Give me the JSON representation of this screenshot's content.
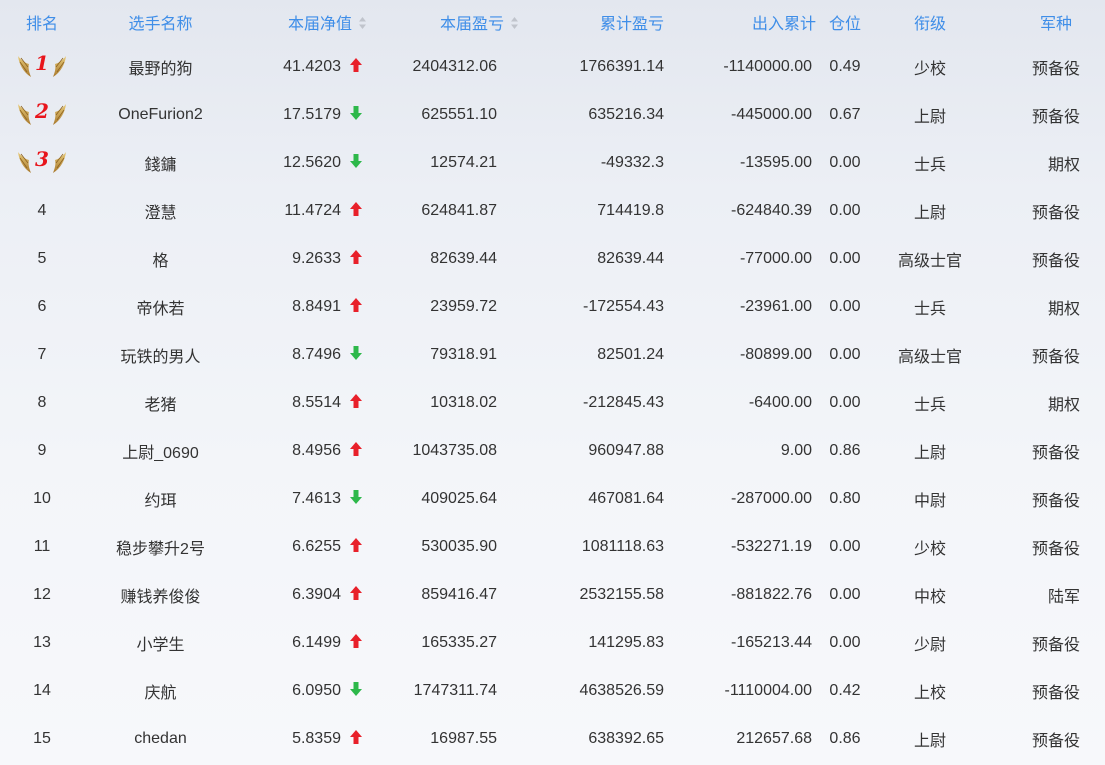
{
  "headers": {
    "rank": "排名",
    "name": "选手名称",
    "nav": "本届净值",
    "pnl": "本届盈亏",
    "cum": "累计盈亏",
    "flow": "出入累计",
    "pos": "仓位",
    "title": "衔级",
    "branch": "军种"
  },
  "colors": {
    "header_text": "#3f8ee8",
    "up_arrow": "#e8202a",
    "down_arrow": "#2db84a",
    "medal_number": "#e8151c"
  },
  "rows": [
    {
      "rank": "1",
      "name": "最野的狗",
      "nav": "41.4203",
      "trend": "up",
      "pnl": "2404312.06",
      "cum": "1766391.14",
      "flow": "-1140000.00",
      "pos": "0.49",
      "title": "少校",
      "branch": "预备役"
    },
    {
      "rank": "2",
      "name": "OneFurion2",
      "nav": "17.5179",
      "trend": "down",
      "pnl": "625551.10",
      "cum": "635216.34",
      "flow": "-445000.00",
      "pos": "0.67",
      "title": "上尉",
      "branch": "预备役"
    },
    {
      "rank": "3",
      "name": "錢鏞",
      "nav": "12.5620",
      "trend": "down",
      "pnl": "12574.21",
      "cum": "-49332.3",
      "flow": "-13595.00",
      "pos": "0.00",
      "title": "士兵",
      "branch": "期权"
    },
    {
      "rank": "4",
      "name": "澄慧",
      "nav": "11.4724",
      "trend": "up",
      "pnl": "624841.87",
      "cum": "714419.8",
      "flow": "-624840.39",
      "pos": "0.00",
      "title": "上尉",
      "branch": "预备役"
    },
    {
      "rank": "5",
      "name": "格",
      "nav": "9.2633",
      "trend": "up",
      "pnl": "82639.44",
      "cum": "82639.44",
      "flow": "-77000.00",
      "pos": "0.00",
      "title": "高级士官",
      "branch": "预备役"
    },
    {
      "rank": "6",
      "name": "帝休若",
      "nav": "8.8491",
      "trend": "up",
      "pnl": "23959.72",
      "cum": "-172554.43",
      "flow": "-23961.00",
      "pos": "0.00",
      "title": "士兵",
      "branch": "期权"
    },
    {
      "rank": "7",
      "name": "玩铁的男人",
      "nav": "8.7496",
      "trend": "down",
      "pnl": "79318.91",
      "cum": "82501.24",
      "flow": "-80899.00",
      "pos": "0.00",
      "title": "高级士官",
      "branch": "预备役"
    },
    {
      "rank": "8",
      "name": "老猪",
      "nav": "8.5514",
      "trend": "up",
      "pnl": "10318.02",
      "cum": "-212845.43",
      "flow": "-6400.00",
      "pos": "0.00",
      "title": "士兵",
      "branch": "期权"
    },
    {
      "rank": "9",
      "name": "上尉_0690",
      "nav": "8.4956",
      "trend": "up",
      "pnl": "1043735.08",
      "cum": "960947.88",
      "flow": "9.00",
      "pos": "0.86",
      "title": "上尉",
      "branch": "预备役"
    },
    {
      "rank": "10",
      "name": "约珥",
      "nav": "7.4613",
      "trend": "down",
      "pnl": "409025.64",
      "cum": "467081.64",
      "flow": "-287000.00",
      "pos": "0.80",
      "title": "中尉",
      "branch": "预备役"
    },
    {
      "rank": "11",
      "name": "稳步攀升2号",
      "nav": "6.6255",
      "trend": "up",
      "pnl": "530035.90",
      "cum": "1081118.63",
      "flow": "-532271.19",
      "pos": "0.00",
      "title": "少校",
      "branch": "预备役"
    },
    {
      "rank": "12",
      "name": "赚钱养俊俊",
      "nav": "6.3904",
      "trend": "up",
      "pnl": "859416.47",
      "cum": "2532155.58",
      "flow": "-881822.76",
      "pos": "0.00",
      "title": "中校",
      "branch": "陆军"
    },
    {
      "rank": "13",
      "name": "小学生",
      "nav": "6.1499",
      "trend": "up",
      "pnl": "165335.27",
      "cum": "141295.83",
      "flow": "-165213.44",
      "pos": "0.00",
      "title": "少尉",
      "branch": "预备役"
    },
    {
      "rank": "14",
      "name": "庆航",
      "nav": "6.0950",
      "trend": "down",
      "pnl": "1747311.74",
      "cum": "4638526.59",
      "flow": "-1110004.00",
      "pos": "0.42",
      "title": "上校",
      "branch": "预备役"
    },
    {
      "rank": "15",
      "name": "chedan",
      "nav": "5.8359",
      "trend": "up",
      "pnl": "16987.55",
      "cum": "638392.65",
      "flow": "212657.68",
      "pos": "0.86",
      "title": "上尉",
      "branch": "预备役"
    }
  ]
}
